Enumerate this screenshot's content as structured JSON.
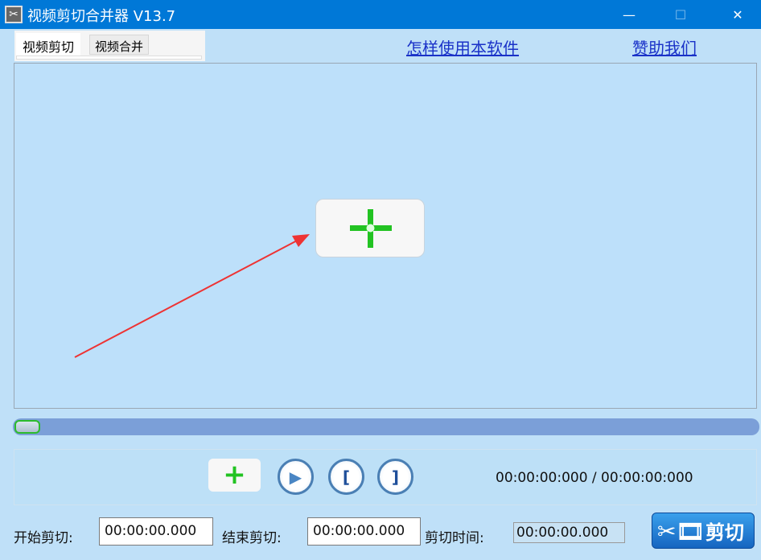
{
  "window": {
    "title": "视频剪切合并器 V13.7",
    "minimize": "—",
    "maximize": "☐",
    "close": "✕"
  },
  "tabs": [
    {
      "label": "视频剪切"
    },
    {
      "label": "视频合并"
    }
  ],
  "links": {
    "howto": "怎样使用本软件",
    "sponsor": "赞助我们"
  },
  "player": {
    "progress": 0,
    "time_display": "00:00:00:000 / 00:00:00:000"
  },
  "controls": {
    "add": "+",
    "play": "▶",
    "mark_in": "[",
    "mark_out": "]"
  },
  "cut": {
    "start_label": "开始剪切:",
    "start_value": "00:00:00.000",
    "end_label": "结束剪切:",
    "end_value": "00:00:00.000",
    "duration_label": "剪切时间:",
    "duration_value": "00:00:00.000",
    "button": "剪切"
  },
  "colors": {
    "titlebar": "#0078d7",
    "link": "#1a32c8",
    "accent_green": "#22c322"
  }
}
